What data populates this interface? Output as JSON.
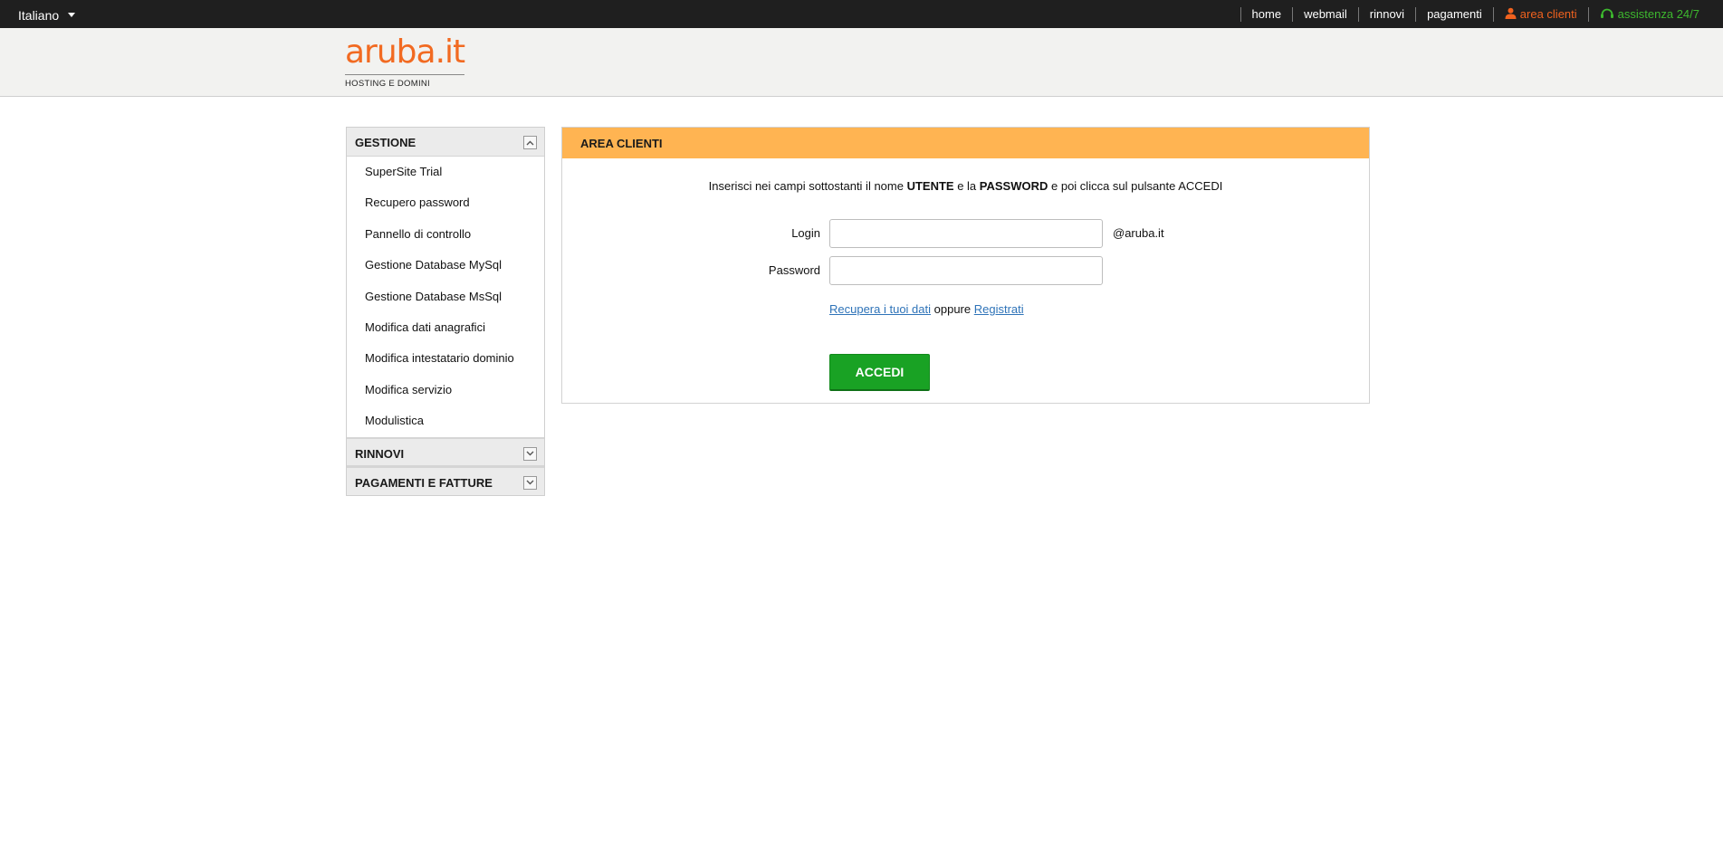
{
  "topbar": {
    "language": "Italiano",
    "nav": [
      {
        "label": "home"
      },
      {
        "label": "webmail"
      },
      {
        "label": "rinnovi"
      },
      {
        "label": "pagamenti"
      }
    ],
    "area_clienti": "area clienti",
    "assistenza": "assistenza 24/7",
    "colors": {
      "background": "#1f1f1f",
      "orange": "#f0621f",
      "green": "#3db82e"
    }
  },
  "header": {
    "logo_text": "aruba.it",
    "logo_sub": "HOSTING E DOMINI",
    "logo_color": "#f26a21"
  },
  "sidebar": {
    "sections": [
      {
        "title": "GESTIONE",
        "expanded": true,
        "toggle_icon": "chevron-up-icon",
        "items": [
          "SuperSite Trial",
          "Recupero password",
          "Pannello di controllo",
          "Gestione Database MySql",
          "Gestione Database MsSql",
          "Modifica dati anagrafici",
          "Modifica intestatario dominio",
          "Modifica servizio",
          "Modulistica"
        ]
      },
      {
        "title": "RINNOVI",
        "expanded": false,
        "toggle_icon": "chevron-down-icon"
      },
      {
        "title": "PAGAMENTI E FATTURE",
        "expanded": false,
        "toggle_icon": "chevron-down-icon"
      }
    ]
  },
  "main": {
    "title": "AREA CLIENTI",
    "header_color": "#ffb452",
    "instructions": {
      "part1": "Inserisci nei campi sottostanti il nome ",
      "bold1": "UTENTE",
      "part2": " e la ",
      "bold2": "PASSWORD",
      "part3": " e poi clicca sul pulsante ACCEDI"
    },
    "login_label": "Login",
    "login_value": "",
    "login_suffix": "@aruba.it",
    "password_label": "Password",
    "password_value": "",
    "recover_link": "Recupera i tuoi dati",
    "oppure": "oppure",
    "register_link": "Registrati",
    "submit_label": "ACCEDI",
    "submit_color": "#19a224"
  }
}
